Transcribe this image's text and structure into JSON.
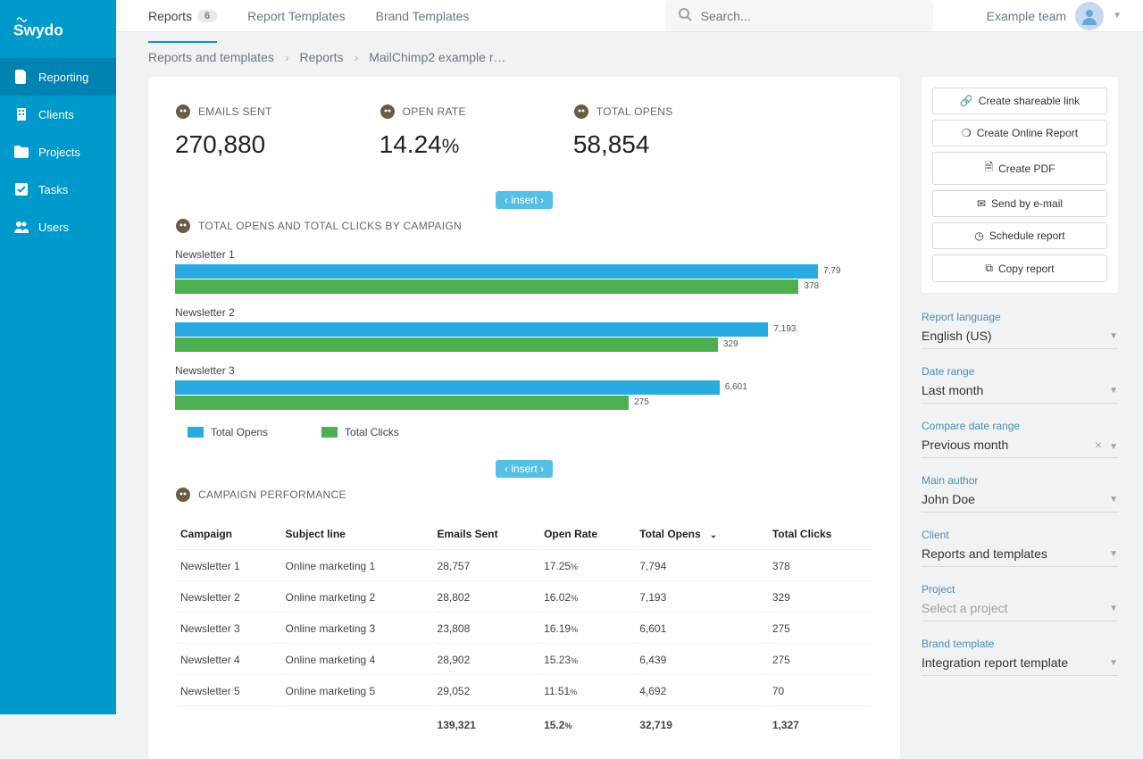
{
  "brand": "Swydo",
  "sidebar": {
    "items": [
      {
        "label": "Reporting",
        "active": true
      },
      {
        "label": "Clients"
      },
      {
        "label": "Projects"
      },
      {
        "label": "Tasks"
      },
      {
        "label": "Users"
      }
    ]
  },
  "topnav": {
    "reports_label": "Reports",
    "reports_count": "6",
    "templates_label": "Report Templates",
    "brand_templates_label": "Brand Templates"
  },
  "search": {
    "placeholder": "Search..."
  },
  "team": {
    "name": "Example team"
  },
  "breadcrumb": {
    "a": "Reports and templates",
    "b": "Reports",
    "c": "MailChimp2 example r…"
  },
  "kpis": {
    "emails_sent": {
      "label": "EMAILS SENT",
      "value": "270,880"
    },
    "open_rate": {
      "label": "OPEN RATE",
      "value": "14.24",
      "suffix": "%"
    },
    "total_opens": {
      "label": "TOTAL OPENS",
      "value": "58,854"
    }
  },
  "insert_label": "‹ insert ›",
  "chart_title": "TOTAL OPENS AND TOTAL CLICKS BY CAMPAIGN",
  "chart_legend": {
    "opens": "Total Opens",
    "clicks": "Total Clicks"
  },
  "chart_data": {
    "type": "bar",
    "orientation": "horizontal",
    "categories": [
      "Newsletter 1",
      "Newsletter 2",
      "Newsletter 3"
    ],
    "series": [
      {
        "name": "Total Opens",
        "color": "#29abe2",
        "values": [
          7794,
          7193,
          6601
        ],
        "labels": [
          "7,79",
          "7,193",
          "6,601"
        ]
      },
      {
        "name": "Total Clicks",
        "color": "#4caf50",
        "values": [
          378,
          329,
          275
        ],
        "labels": [
          "378",
          "329",
          "275"
        ]
      }
    ],
    "xmax_opens": 7794,
    "xmax_clicks": 378
  },
  "table_title": "CAMPAIGN PERFORMANCE",
  "table": {
    "headers": [
      "Campaign",
      "Subject line",
      "Emails Sent",
      "Open Rate",
      "Total Opens",
      "Total Clicks"
    ],
    "rows": [
      [
        "Newsletter 1",
        "Online marketing 1",
        "28,757",
        "17.25",
        "7,794",
        "378"
      ],
      [
        "Newsletter 2",
        "Online marketing 2",
        "28,802",
        "16.02",
        "7,193",
        "329"
      ],
      [
        "Newsletter 3",
        "Online marketing 3",
        "23,808",
        "16.19",
        "6,601",
        "275"
      ],
      [
        "Newsletter 4",
        "Online marketing 4",
        "28,902",
        "15.23",
        "6,439",
        "275"
      ],
      [
        "Newsletter 5",
        "Online marketing 5",
        "29,052",
        "11.51",
        "4,692",
        "70"
      ]
    ],
    "totals": [
      "",
      "",
      "139,321",
      "15.2",
      "32,719",
      "1,327"
    ]
  },
  "actions": {
    "share": "Create shareable link",
    "online": "Create Online Report",
    "pdf": "Create PDF",
    "email": "Send by e-mail",
    "schedule": "Schedule report",
    "copy": "Copy report"
  },
  "settings": {
    "language_label": "Report language",
    "language_value": "English (US)",
    "date_range_label": "Date range",
    "date_range_value": "Last month",
    "compare_label": "Compare date range",
    "compare_value": "Previous month",
    "author_label": "Main author",
    "author_value": "John Doe",
    "client_label": "Client",
    "client_value": "Reports and templates",
    "project_label": "Project",
    "project_value": "Select a project",
    "brand_label": "Brand template",
    "brand_value": "Integration report template"
  }
}
